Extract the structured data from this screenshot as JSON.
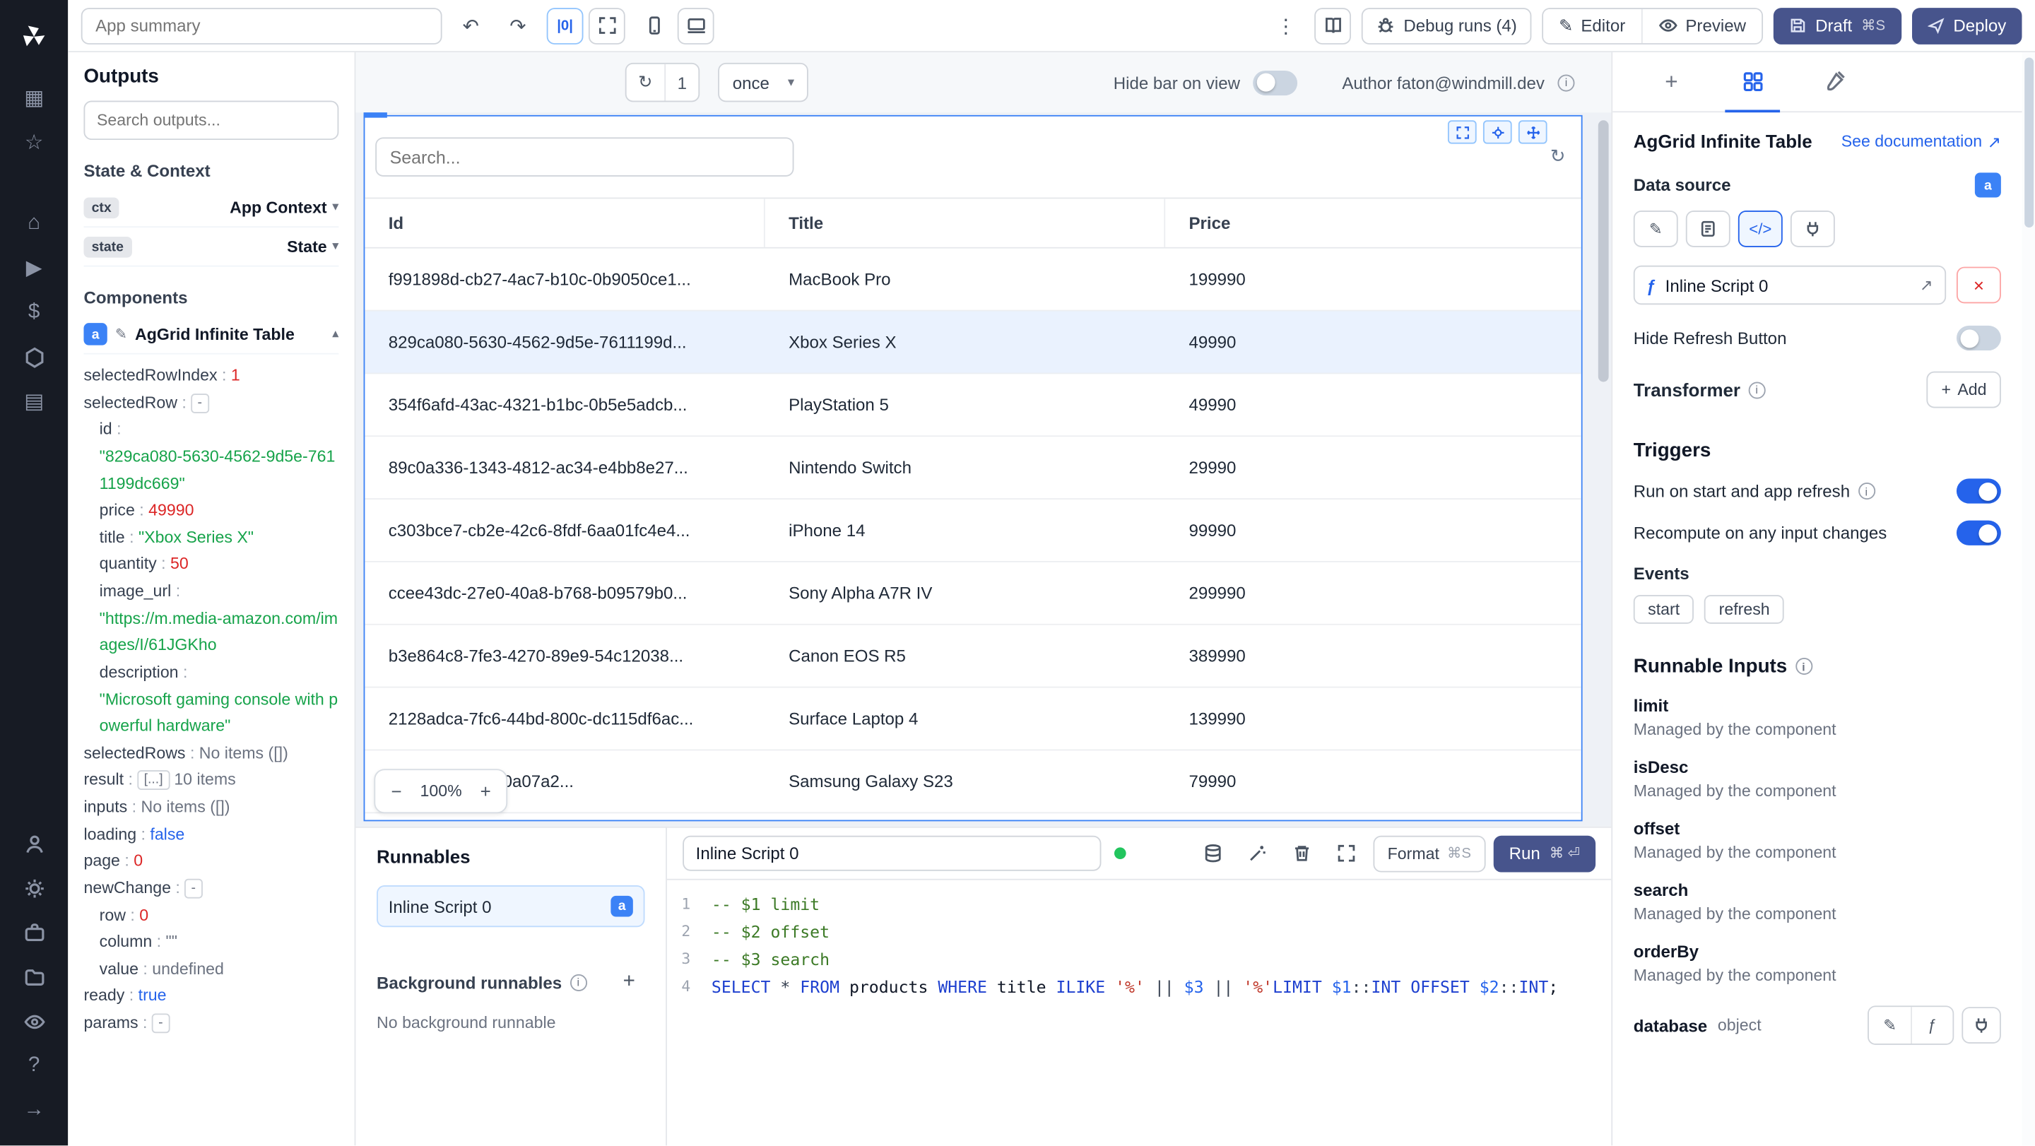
{
  "icons": {
    "undo": "↶",
    "redo": "↷",
    "kebab": "⋮",
    "pencil": "✎",
    "refresh": "↻",
    "chev_down": "▾",
    "chev_up": "▴",
    "minus": "−",
    "plus": "+",
    "close": "×",
    "external": "↗",
    "info": "i",
    "columns": "|0|",
    "code": "</>",
    "fn": "ƒ",
    "grid": "▦",
    "star": "☆",
    "home": "⌂",
    "play": "▶",
    "dollar": "$",
    "calendar": "▤",
    "help": "?",
    "arrow_right": "→"
  },
  "topbar": {
    "summary_placeholder": "App summary",
    "debug_runs_label": "Debug runs (4)",
    "editor_label": "Editor",
    "preview_label": "Preview",
    "draft_label": "Draft",
    "draft_shortcut": "⌘S",
    "deploy_label": "Deploy"
  },
  "canvas_toolbar": {
    "refresh_count": "1",
    "interval_label": "once",
    "hide_bar_label": "Hide bar on view",
    "author_label": "Author faton@windmill.dev"
  },
  "outputs": {
    "title": "Outputs",
    "search_placeholder": "Search outputs...",
    "state_context_title": "State & Context",
    "ctx_chip": "ctx",
    "ctx_value": "App Context",
    "state_chip": "state",
    "state_value": "State",
    "components_title": "Components",
    "component_badge": "a",
    "component_name": "AgGrid Infinite Table",
    "tree": [
      {
        "key": "selectedRowIndex",
        "value": "1",
        "type": "num",
        "indent": 0
      },
      {
        "key": "selectedRow",
        "value": "-",
        "type": "chip",
        "indent": 0
      },
      {
        "key": "id",
        "value": "\"829ca080-5630-4562-9d5e-7611199dc669\"",
        "type": "str",
        "indent": 1,
        "wrap": true
      },
      {
        "key": "price",
        "value": "49990",
        "type": "num",
        "indent": 1
      },
      {
        "key": "title",
        "value": "\"Xbox Series X\"",
        "type": "str",
        "indent": 1
      },
      {
        "key": "quantity",
        "value": "50",
        "type": "num",
        "indent": 1
      },
      {
        "key": "image_url",
        "value": "\"https://m.media-amazon.com/images/I/61JGKho",
        "type": "str",
        "indent": 1,
        "wrap": true
      },
      {
        "key": "description",
        "value": "\"Microsoft gaming console with powerful hardware\"",
        "type": "str",
        "indent": 1,
        "wrap": true
      },
      {
        "key": "selectedRows",
        "value": "No items ([])",
        "type": "muted",
        "indent": 0
      },
      {
        "key": "result",
        "chip_value": "[...]",
        "value": "10 items",
        "type": "muted",
        "indent": 0
      },
      {
        "key": "inputs",
        "value": "No items ([])",
        "type": "muted",
        "indent": 0
      },
      {
        "key": "loading",
        "value": "false",
        "type": "bool",
        "indent": 0
      },
      {
        "key": "page",
        "value": "0",
        "type": "num",
        "indent": 0
      },
      {
        "key": "newChange",
        "value": "-",
        "type": "chip",
        "indent": 0
      },
      {
        "key": "row",
        "value": "0",
        "type": "num",
        "indent": 1
      },
      {
        "key": "column",
        "value": "\"\"",
        "type": "muted",
        "indent": 1
      },
      {
        "key": "value",
        "value": "undefined",
        "type": "muted",
        "indent": 1
      },
      {
        "key": "ready",
        "value": "true",
        "type": "bool",
        "indent": 0
      },
      {
        "key": "params",
        "value": "-",
        "type": "chip",
        "indent": 0
      }
    ]
  },
  "grid": {
    "badge": "a",
    "search_placeholder": "Search...",
    "columns": [
      "Id",
      "Title",
      "Price"
    ],
    "selected_index": 1,
    "zoom": "100%",
    "rows": [
      [
        "f991898d-cb27-4ac7-b10c-0b9050ce1...",
        "MacBook Pro",
        "199990"
      ],
      [
        "829ca080-5630-4562-9d5e-7611199d...",
        "Xbox Series X",
        "49990"
      ],
      [
        "354f6afd-43ac-4321-b1bc-0b5e5adcb...",
        "PlayStation 5",
        "49990"
      ],
      [
        "89c0a336-1343-4812-ac34-e4bb8e27...",
        "Nintendo Switch",
        "29990"
      ],
      [
        "c303bce7-cb2e-42c6-8fdf-6aa01fc4e4...",
        "iPhone 14",
        "99990"
      ],
      [
        "ccee43dc-27e0-40a8-b768-b09579b0...",
        "Sony Alpha A7R IV",
        "299990"
      ],
      [
        "b3e864c8-7fe3-4270-89e9-54c12038...",
        "Canon EOS R5",
        "389990"
      ],
      [
        "2128adca-7fc6-44bd-800c-dc115df6ac...",
        "Surface Laptop 4",
        "139990"
      ],
      [
        "4c83-8022-5e70a07a2...",
        "Samsung Galaxy S23",
        "79990"
      ]
    ]
  },
  "runnables": {
    "title": "Runnables",
    "item_label": "Inline Script 0",
    "item_badge": "a",
    "background_title": "Background runnables",
    "background_empty": "No background runnable"
  },
  "editor": {
    "name": "Inline Script 0",
    "format_label": "Format",
    "format_shortcut": "⌘S",
    "run_label": "Run",
    "run_shortcut": "⌘ ⏎",
    "lines": [
      {
        "num": "1",
        "tokens": [
          [
            "-- $1 limit",
            "c"
          ]
        ]
      },
      {
        "num": "2",
        "tokens": [
          [
            "-- $2 offset",
            "c"
          ]
        ]
      },
      {
        "num": "3",
        "tokens": [
          [
            "-- $3 search",
            "c"
          ]
        ]
      },
      {
        "num": "4",
        "tokens": [
          [
            "SELECT",
            "k"
          ],
          [
            " ",
            "p"
          ],
          [
            "*",
            "o"
          ],
          [
            " ",
            "p"
          ],
          [
            "FROM",
            "k"
          ],
          [
            " products ",
            "p"
          ],
          [
            "WHERE",
            "k"
          ],
          [
            " title ",
            "p"
          ],
          [
            "ILIKE",
            "k"
          ],
          [
            " ",
            "p"
          ],
          [
            "'%'",
            "s"
          ],
          [
            " ",
            "p"
          ],
          [
            "||",
            "o"
          ],
          [
            " ",
            "p"
          ],
          [
            "$3",
            "v"
          ],
          [
            " ",
            "p"
          ],
          [
            "||",
            "o"
          ],
          [
            " ",
            "p"
          ],
          [
            "'%'",
            "s"
          ],
          [
            "LIMIT",
            "k"
          ],
          [
            " ",
            "p"
          ],
          [
            "$1",
            "v"
          ],
          [
            "::",
            "o"
          ],
          [
            "INT",
            "k"
          ],
          [
            " ",
            "p"
          ],
          [
            "OFFSET",
            "k"
          ],
          [
            " ",
            "p"
          ],
          [
            "$2",
            "v"
          ],
          [
            "::",
            "o"
          ],
          [
            "INT",
            "k"
          ],
          [
            ";",
            "p"
          ]
        ]
      }
    ]
  },
  "right": {
    "title": "AgGrid Infinite Table",
    "doc_link": "See documentation",
    "data_source_label": "Data source",
    "badge": "a",
    "script_chip": "Inline Script 0",
    "hide_refresh_label": "Hide Refresh Button",
    "transformer_label": "Transformer",
    "add_label": "Add",
    "triggers_title": "Triggers",
    "trigger_run_label": "Run on start and app refresh",
    "trigger_recompute_label": "Recompute on any input changes",
    "events_label": "Events",
    "events": [
      "start",
      "refresh"
    ],
    "runnable_inputs_title": "Runnable Inputs",
    "inputs": [
      {
        "name": "limit",
        "desc": "Managed by the component"
      },
      {
        "name": "isDesc",
        "desc": "Managed by the component"
      },
      {
        "name": "offset",
        "desc": "Managed by the component"
      },
      {
        "name": "search",
        "desc": "Managed by the component"
      },
      {
        "name": "orderBy",
        "desc": "Managed by the component"
      }
    ],
    "database_label": "database",
    "database_type": "object"
  }
}
